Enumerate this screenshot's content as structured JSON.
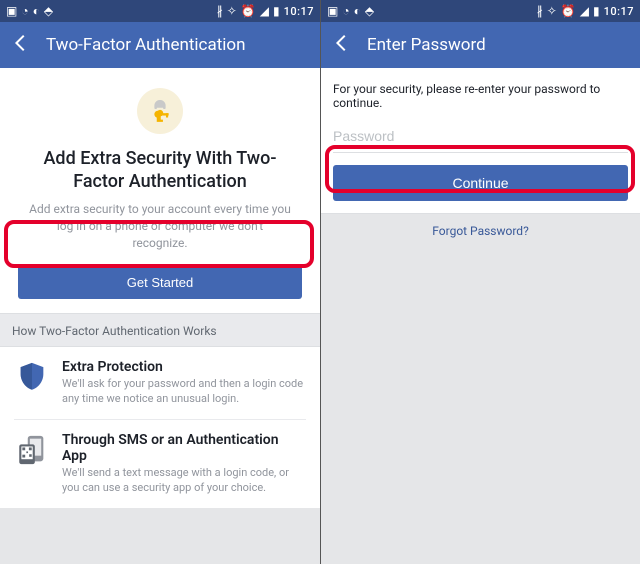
{
  "statusbar": {
    "time": "10:17"
  },
  "screen1": {
    "header_title": "Two-Factor Authentication",
    "heading": "Add Extra Security With Two-Factor Authentication",
    "subheading": "Add extra security to your account every time you log in on a phone or computer we don't recognize.",
    "get_started_label": "Get Started",
    "section_label": "How Two-Factor Authentication Works",
    "items": [
      {
        "title": "Extra Protection",
        "desc": "We'll ask for your password and then a login code any time we notice an unusual login."
      },
      {
        "title": "Through SMS or an Authentication App",
        "desc": "We'll send a text message with a login code, or you can use a security app of your choice."
      }
    ]
  },
  "screen2": {
    "header_title": "Enter Password",
    "prompt": "For your security, please re-enter your password to continue.",
    "password_placeholder": "Password",
    "continue_label": "Continue",
    "forgot_label": "Forgot Password?"
  }
}
